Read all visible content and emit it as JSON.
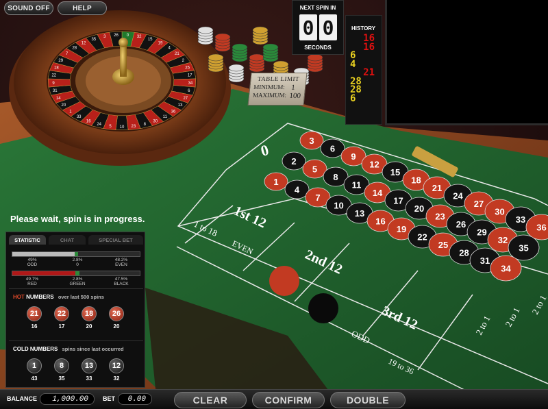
{
  "top_buttons": {
    "sound_off": "SOUND OFF",
    "help": "HELP"
  },
  "next_spin": {
    "title": "NEXT SPIN IN",
    "digits": [
      "0",
      "0"
    ],
    "unit": "SECONDS"
  },
  "history": {
    "title": "HISTORY",
    "entries": [
      {
        "number": "16",
        "color": "red",
        "side": "right"
      },
      {
        "number": "16",
        "color": "red",
        "side": "right"
      },
      {
        "number": "6",
        "color": "yellow",
        "side": "left"
      },
      {
        "number": "4",
        "color": "yellow",
        "side": "left"
      },
      {
        "number": "21",
        "color": "red",
        "side": "right"
      },
      {
        "number": "28",
        "color": "yellow",
        "side": "left"
      },
      {
        "number": "28",
        "color": "yellow",
        "side": "left"
      },
      {
        "number": "6",
        "color": "yellow",
        "side": "left"
      }
    ]
  },
  "table_limit": {
    "title": "TABLE LIMIT",
    "min_label": "MINIMUM:",
    "min_value": "1",
    "max_label": "MAXIMUM:",
    "max_value": "100"
  },
  "status_message": "Please wait, spin is in progress.",
  "stats_panel": {
    "tabs": {
      "statistic": "STATISTIC",
      "chat": "CHAT",
      "special": "SPECIAL BET"
    },
    "odd_even": {
      "left_pct": "49%",
      "left_label": "ODD",
      "mid_pct": "2.8%",
      "mid_label": "0",
      "right_pct": "48.2%",
      "right_label": "EVEN",
      "left_value": 49,
      "mid_value": 2.8,
      "right_value": 48.2
    },
    "red_black": {
      "left_pct": "49.7%",
      "left_label": "RED",
      "mid_pct": "2.8%",
      "mid_label": "GREEN",
      "right_pct": "47.5%",
      "right_label": "BLACK",
      "left_value": 49.7,
      "mid_value": 2.8,
      "right_value": 47.5
    },
    "hot": {
      "word1": "HOT",
      "word2": "NUMBERS",
      "sub": "over last 500 spins",
      "balls": [
        {
          "n": "21",
          "c": "red",
          "count": "16"
        },
        {
          "n": "22",
          "c": "red",
          "count": "17"
        },
        {
          "n": "18",
          "c": "red",
          "count": "20"
        },
        {
          "n": "26",
          "c": "red",
          "count": "20"
        }
      ]
    },
    "cold": {
      "word1": "COLD",
      "word2": "NUMBERS",
      "sub": "spins since last occurred",
      "balls": [
        {
          "n": "1",
          "c": "black",
          "count": "43"
        },
        {
          "n": "8",
          "c": "black",
          "count": "35"
        },
        {
          "n": "13",
          "c": "black",
          "count": "33"
        },
        {
          "n": "12",
          "c": "black",
          "count": "32"
        }
      ]
    }
  },
  "table_layout": {
    "zero": "0",
    "columns": [
      [
        {
          "n": "3",
          "c": "red"
        },
        {
          "n": "2",
          "c": "black"
        },
        {
          "n": "1",
          "c": "red"
        }
      ],
      [
        {
          "n": "6",
          "c": "black"
        },
        {
          "n": "5",
          "c": "red"
        },
        {
          "n": "4",
          "c": "black"
        }
      ],
      [
        {
          "n": "9",
          "c": "red"
        },
        {
          "n": "8",
          "c": "black"
        },
        {
          "n": "7",
          "c": "red"
        }
      ],
      [
        {
          "n": "12",
          "c": "red"
        },
        {
          "n": "11",
          "c": "black"
        },
        {
          "n": "10",
          "c": "black"
        }
      ],
      [
        {
          "n": "15",
          "c": "black"
        },
        {
          "n": "14",
          "c": "red"
        },
        {
          "n": "13",
          "c": "black"
        }
      ],
      [
        {
          "n": "18",
          "c": "red"
        },
        {
          "n": "17",
          "c": "black"
        },
        {
          "n": "16",
          "c": "red"
        }
      ],
      [
        {
          "n": "21",
          "c": "red"
        },
        {
          "n": "20",
          "c": "black"
        },
        {
          "n": "19",
          "c": "red"
        }
      ],
      [
        {
          "n": "24",
          "c": "black"
        },
        {
          "n": "23",
          "c": "red"
        },
        {
          "n": "22",
          "c": "black"
        }
      ],
      [
        {
          "n": "27",
          "c": "red"
        },
        {
          "n": "26",
          "c": "black"
        },
        {
          "n": "25",
          "c": "red"
        }
      ],
      [
        {
          "n": "30",
          "c": "red"
        },
        {
          "n": "29",
          "c": "black"
        },
        {
          "n": "28",
          "c": "black"
        }
      ],
      [
        {
          "n": "33",
          "c": "black"
        },
        {
          "n": "32",
          "c": "red"
        },
        {
          "n": "31",
          "c": "black"
        }
      ],
      [
        {
          "n": "36",
          "c": "red"
        },
        {
          "n": "35",
          "c": "black"
        },
        {
          "n": "34",
          "c": "red"
        }
      ]
    ],
    "dozens": [
      "1st 12",
      "2nd 12",
      "3rd 12"
    ],
    "outside": {
      "low": "1 to 18",
      "even": "EVEN",
      "odd": "ODD",
      "high": "19 to 36"
    },
    "column_bets": [
      "2 to 1",
      "2 to 1",
      "2 to 1"
    ]
  },
  "bottom_bar": {
    "balance_label": "BALANCE",
    "balance_value": "1,000.00",
    "bet_label": "BET",
    "bet_value": "0.00",
    "clear": "CLEAR",
    "confirm": "CONFIRM",
    "double": "DOUBLE"
  },
  "colors": {
    "felt": "#1f5e2c",
    "red": "#c23a22",
    "black": "#121212",
    "wood": "#7a3c1c",
    "hot_accent": "#e04a2a",
    "history_red": "#e01010",
    "history_yellow": "#e8d020"
  },
  "wheel_numbers": [
    "0",
    "32",
    "15",
    "19",
    "4",
    "21",
    "2",
    "25",
    "17",
    "34",
    "6",
    "27",
    "13",
    "36",
    "11",
    "30",
    "8",
    "23",
    "10",
    "5",
    "24",
    "16",
    "33",
    "1",
    "20",
    "14",
    "31",
    "9",
    "22",
    "18",
    "29",
    "7",
    "28",
    "12",
    "35",
    "3",
    "26"
  ]
}
